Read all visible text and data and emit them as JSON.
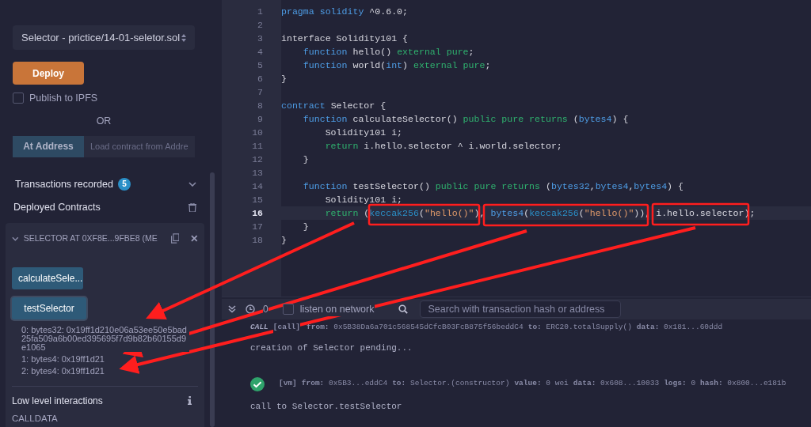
{
  "deploy_panel": {
    "contract_select": "Selector - prictice/14-01-seletor.sol",
    "deploy_button": "Deploy",
    "publish_ipfs": {
      "label": "Publish to IPFS",
      "checked": false
    },
    "or_label": "OR",
    "at_address_button": "At Address",
    "at_address_placeholder": "Load contract from Addre",
    "transactions_recorded": {
      "label": "Transactions recorded",
      "count": "5",
      "expanded": false
    },
    "deployed_contracts": "Deployed Contracts",
    "instance": {
      "title": "SELECTOR AT 0XF8E...9FBE8 (ME",
      "expanded": true,
      "functions": [
        {
          "label": "calculateSele...",
          "selected": false
        },
        {
          "label": "testSelector",
          "selected": true
        }
      ],
      "outputs": [
        "0: bytes32: 0x19ff1d210e06a53ee50e5bad25fa509a6b00ed395695f7d9b82b60155d9e1065",
        "1: bytes4: 0x19ff1d21",
        "2: bytes4: 0x19ff1d21"
      ],
      "low_level_title": "Low level interactions",
      "calldata_label": "CALLDATA"
    }
  },
  "editor": {
    "lines": [
      {
        "number": "1",
        "active": false,
        "tokens": [
          {
            "kind": "keyword",
            "text": "pragma solidity"
          },
          {
            "kind": "plain",
            "text": " ^0.6.0;"
          }
        ]
      },
      {
        "number": "2",
        "active": false
      },
      {
        "number": "3",
        "active": false,
        "tokens": [
          {
            "kind": "plain",
            "text": "interface Solidity101 {"
          }
        ]
      },
      {
        "number": "4",
        "active": false,
        "tokens": [
          {
            "kind": "keyword",
            "text": "    function"
          },
          {
            "kind": "plain",
            "text": " hello() "
          },
          {
            "kind": "modifier",
            "text": "external pure"
          },
          {
            "kind": "plain",
            "text": ";"
          }
        ]
      },
      {
        "number": "5",
        "active": false,
        "tokens": [
          {
            "kind": "keyword",
            "text": "    function"
          },
          {
            "kind": "plain",
            "text": " world("
          },
          {
            "kind": "keyword",
            "text": "int"
          },
          {
            "kind": "plain",
            "text": ") "
          },
          {
            "kind": "modifier",
            "text": "external pure"
          },
          {
            "kind": "plain",
            "text": ";"
          }
        ]
      },
      {
        "number": "6",
        "active": false,
        "tokens": [
          {
            "kind": "plain",
            "text": "}"
          }
        ]
      },
      {
        "number": "7",
        "active": false
      },
      {
        "number": "8",
        "active": false,
        "tokens": [
          {
            "kind": "keyword",
            "text": "contract"
          },
          {
            "kind": "plain",
            "text": " Selector {"
          }
        ]
      },
      {
        "number": "9",
        "active": false,
        "tokens": [
          {
            "kind": "keyword",
            "text": "    function"
          },
          {
            "kind": "plain",
            "text": " calculateSelector() "
          },
          {
            "kind": "modifier",
            "text": "public pure returns"
          },
          {
            "kind": "plain",
            "text": " ("
          },
          {
            "kind": "keyword",
            "text": "bytes4"
          },
          {
            "kind": "plain",
            "text": ") {"
          }
        ]
      },
      {
        "number": "10",
        "active": false,
        "tokens": [
          {
            "kind": "plain",
            "text": "        Solidity101 i;"
          }
        ]
      },
      {
        "number": "11",
        "active": false,
        "tokens": [
          {
            "kind": "modifier",
            "text": "        return"
          },
          {
            "kind": "plain",
            "text": " i.hello.selector ^ i.world.selector;"
          }
        ]
      },
      {
        "number": "12",
        "active": false,
        "tokens": [
          {
            "kind": "plain",
            "text": "    }"
          }
        ]
      },
      {
        "number": "13",
        "active": false
      },
      {
        "number": "14",
        "active": false,
        "tokens": [
          {
            "kind": "keyword",
            "text": "    function"
          },
          {
            "kind": "plain",
            "text": " testSelector() "
          },
          {
            "kind": "modifier",
            "text": "public pure returns"
          },
          {
            "kind": "plain",
            "text": " ("
          },
          {
            "kind": "keyword",
            "text": "bytes32"
          },
          {
            "kind": "plain",
            "text": ","
          },
          {
            "kind": "keyword",
            "text": "bytes4"
          },
          {
            "kind": "plain",
            "text": ","
          },
          {
            "kind": "keyword",
            "text": "bytes4"
          },
          {
            "kind": "plain",
            "text": ") {"
          }
        ]
      },
      {
        "number": "15",
        "active": false,
        "tokens": [
          {
            "kind": "plain",
            "text": "        Solidity101 i;"
          }
        ]
      },
      {
        "number": "16",
        "active": true,
        "tokens": [
          {
            "kind": "modifier",
            "text": "        return"
          },
          {
            "kind": "plain",
            "text": " ("
          },
          {
            "kind": "builtin",
            "text": "keccak256"
          },
          {
            "kind": "plain",
            "text": "("
          },
          {
            "kind": "string",
            "text": "\"hello()\""
          },
          {
            "kind": "plain",
            "text": "), "
          },
          {
            "kind": "keyword",
            "text": "bytes4"
          },
          {
            "kind": "plain",
            "text": "("
          },
          {
            "kind": "builtin",
            "text": "keccak256"
          },
          {
            "kind": "plain",
            "text": "("
          },
          {
            "kind": "string",
            "text": "\"hello()\""
          },
          {
            "kind": "plain",
            "text": ")), i.hello.selector);"
          }
        ]
      },
      {
        "number": "17",
        "active": false,
        "tokens": [
          {
            "kind": "plain",
            "text": "    }"
          }
        ]
      },
      {
        "number": "18",
        "active": false,
        "tokens": [
          {
            "kind": "plain",
            "text": "}"
          }
        ]
      }
    ]
  },
  "terminal": {
    "pending_count": "0",
    "listen": {
      "label": "listen on network",
      "checked": false
    },
    "search_placeholder": "Search with transaction hash or address",
    "logs": [
      {
        "kind": "call",
        "label": "CALL",
        "tag": "[call]",
        "pairs": [
          {
            "key": "from:",
            "value": "0x5B38Da6a701c568545dCfcB03FcB875f56beddC4"
          },
          {
            "key": "to:",
            "value": "ERC20.totalSupply()"
          },
          {
            "key": "data:",
            "value": "0x181...60ddd"
          }
        ]
      },
      {
        "kind": "text",
        "text": "creation of Selector pending..."
      },
      {
        "kind": "tx",
        "tag": "[vm]",
        "pairs": [
          {
            "key": "from:",
            "value": "0x5B3...eddC4"
          },
          {
            "key": "to:",
            "value": "Selector.(constructor)"
          },
          {
            "key": "value:",
            "value": "0 wei"
          },
          {
            "key": "data:",
            "value": "0x608...10033"
          },
          {
            "key": "logs:",
            "value": "0"
          },
          {
            "key": "hash:",
            "value": "0x800...e181b"
          }
        ]
      },
      {
        "kind": "text",
        "text": "call to Selector.testSelector"
      }
    ]
  }
}
